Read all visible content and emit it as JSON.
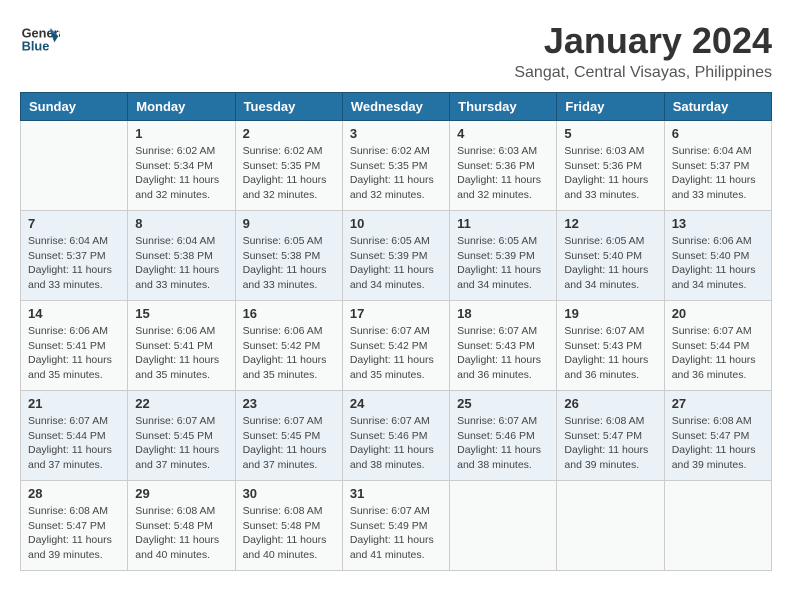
{
  "logo": {
    "line1": "General",
    "line2": "Blue"
  },
  "title": "January 2024",
  "subtitle": "Sangat, Central Visayas, Philippines",
  "days_header": [
    "Sunday",
    "Monday",
    "Tuesday",
    "Wednesday",
    "Thursday",
    "Friday",
    "Saturday"
  ],
  "weeks": [
    [
      {
        "num": "",
        "info": ""
      },
      {
        "num": "1",
        "info": "Sunrise: 6:02 AM\nSunset: 5:34 PM\nDaylight: 11 hours\nand 32 minutes."
      },
      {
        "num": "2",
        "info": "Sunrise: 6:02 AM\nSunset: 5:35 PM\nDaylight: 11 hours\nand 32 minutes."
      },
      {
        "num": "3",
        "info": "Sunrise: 6:02 AM\nSunset: 5:35 PM\nDaylight: 11 hours\nand 32 minutes."
      },
      {
        "num": "4",
        "info": "Sunrise: 6:03 AM\nSunset: 5:36 PM\nDaylight: 11 hours\nand 32 minutes."
      },
      {
        "num": "5",
        "info": "Sunrise: 6:03 AM\nSunset: 5:36 PM\nDaylight: 11 hours\nand 33 minutes."
      },
      {
        "num": "6",
        "info": "Sunrise: 6:04 AM\nSunset: 5:37 PM\nDaylight: 11 hours\nand 33 minutes."
      }
    ],
    [
      {
        "num": "7",
        "info": "Sunrise: 6:04 AM\nSunset: 5:37 PM\nDaylight: 11 hours\nand 33 minutes."
      },
      {
        "num": "8",
        "info": "Sunrise: 6:04 AM\nSunset: 5:38 PM\nDaylight: 11 hours\nand 33 minutes."
      },
      {
        "num": "9",
        "info": "Sunrise: 6:05 AM\nSunset: 5:38 PM\nDaylight: 11 hours\nand 33 minutes."
      },
      {
        "num": "10",
        "info": "Sunrise: 6:05 AM\nSunset: 5:39 PM\nDaylight: 11 hours\nand 34 minutes."
      },
      {
        "num": "11",
        "info": "Sunrise: 6:05 AM\nSunset: 5:39 PM\nDaylight: 11 hours\nand 34 minutes."
      },
      {
        "num": "12",
        "info": "Sunrise: 6:05 AM\nSunset: 5:40 PM\nDaylight: 11 hours\nand 34 minutes."
      },
      {
        "num": "13",
        "info": "Sunrise: 6:06 AM\nSunset: 5:40 PM\nDaylight: 11 hours\nand 34 minutes."
      }
    ],
    [
      {
        "num": "14",
        "info": "Sunrise: 6:06 AM\nSunset: 5:41 PM\nDaylight: 11 hours\nand 35 minutes."
      },
      {
        "num": "15",
        "info": "Sunrise: 6:06 AM\nSunset: 5:41 PM\nDaylight: 11 hours\nand 35 minutes."
      },
      {
        "num": "16",
        "info": "Sunrise: 6:06 AM\nSunset: 5:42 PM\nDaylight: 11 hours\nand 35 minutes."
      },
      {
        "num": "17",
        "info": "Sunrise: 6:07 AM\nSunset: 5:42 PM\nDaylight: 11 hours\nand 35 minutes."
      },
      {
        "num": "18",
        "info": "Sunrise: 6:07 AM\nSunset: 5:43 PM\nDaylight: 11 hours\nand 36 minutes."
      },
      {
        "num": "19",
        "info": "Sunrise: 6:07 AM\nSunset: 5:43 PM\nDaylight: 11 hours\nand 36 minutes."
      },
      {
        "num": "20",
        "info": "Sunrise: 6:07 AM\nSunset: 5:44 PM\nDaylight: 11 hours\nand 36 minutes."
      }
    ],
    [
      {
        "num": "21",
        "info": "Sunrise: 6:07 AM\nSunset: 5:44 PM\nDaylight: 11 hours\nand 37 minutes."
      },
      {
        "num": "22",
        "info": "Sunrise: 6:07 AM\nSunset: 5:45 PM\nDaylight: 11 hours\nand 37 minutes."
      },
      {
        "num": "23",
        "info": "Sunrise: 6:07 AM\nSunset: 5:45 PM\nDaylight: 11 hours\nand 37 minutes."
      },
      {
        "num": "24",
        "info": "Sunrise: 6:07 AM\nSunset: 5:46 PM\nDaylight: 11 hours\nand 38 minutes."
      },
      {
        "num": "25",
        "info": "Sunrise: 6:07 AM\nSunset: 5:46 PM\nDaylight: 11 hours\nand 38 minutes."
      },
      {
        "num": "26",
        "info": "Sunrise: 6:08 AM\nSunset: 5:47 PM\nDaylight: 11 hours\nand 39 minutes."
      },
      {
        "num": "27",
        "info": "Sunrise: 6:08 AM\nSunset: 5:47 PM\nDaylight: 11 hours\nand 39 minutes."
      }
    ],
    [
      {
        "num": "28",
        "info": "Sunrise: 6:08 AM\nSunset: 5:47 PM\nDaylight: 11 hours\nand 39 minutes."
      },
      {
        "num": "29",
        "info": "Sunrise: 6:08 AM\nSunset: 5:48 PM\nDaylight: 11 hours\nand 40 minutes."
      },
      {
        "num": "30",
        "info": "Sunrise: 6:08 AM\nSunset: 5:48 PM\nDaylight: 11 hours\nand 40 minutes."
      },
      {
        "num": "31",
        "info": "Sunrise: 6:07 AM\nSunset: 5:49 PM\nDaylight: 11 hours\nand 41 minutes."
      },
      {
        "num": "",
        "info": ""
      },
      {
        "num": "",
        "info": ""
      },
      {
        "num": "",
        "info": ""
      }
    ]
  ]
}
